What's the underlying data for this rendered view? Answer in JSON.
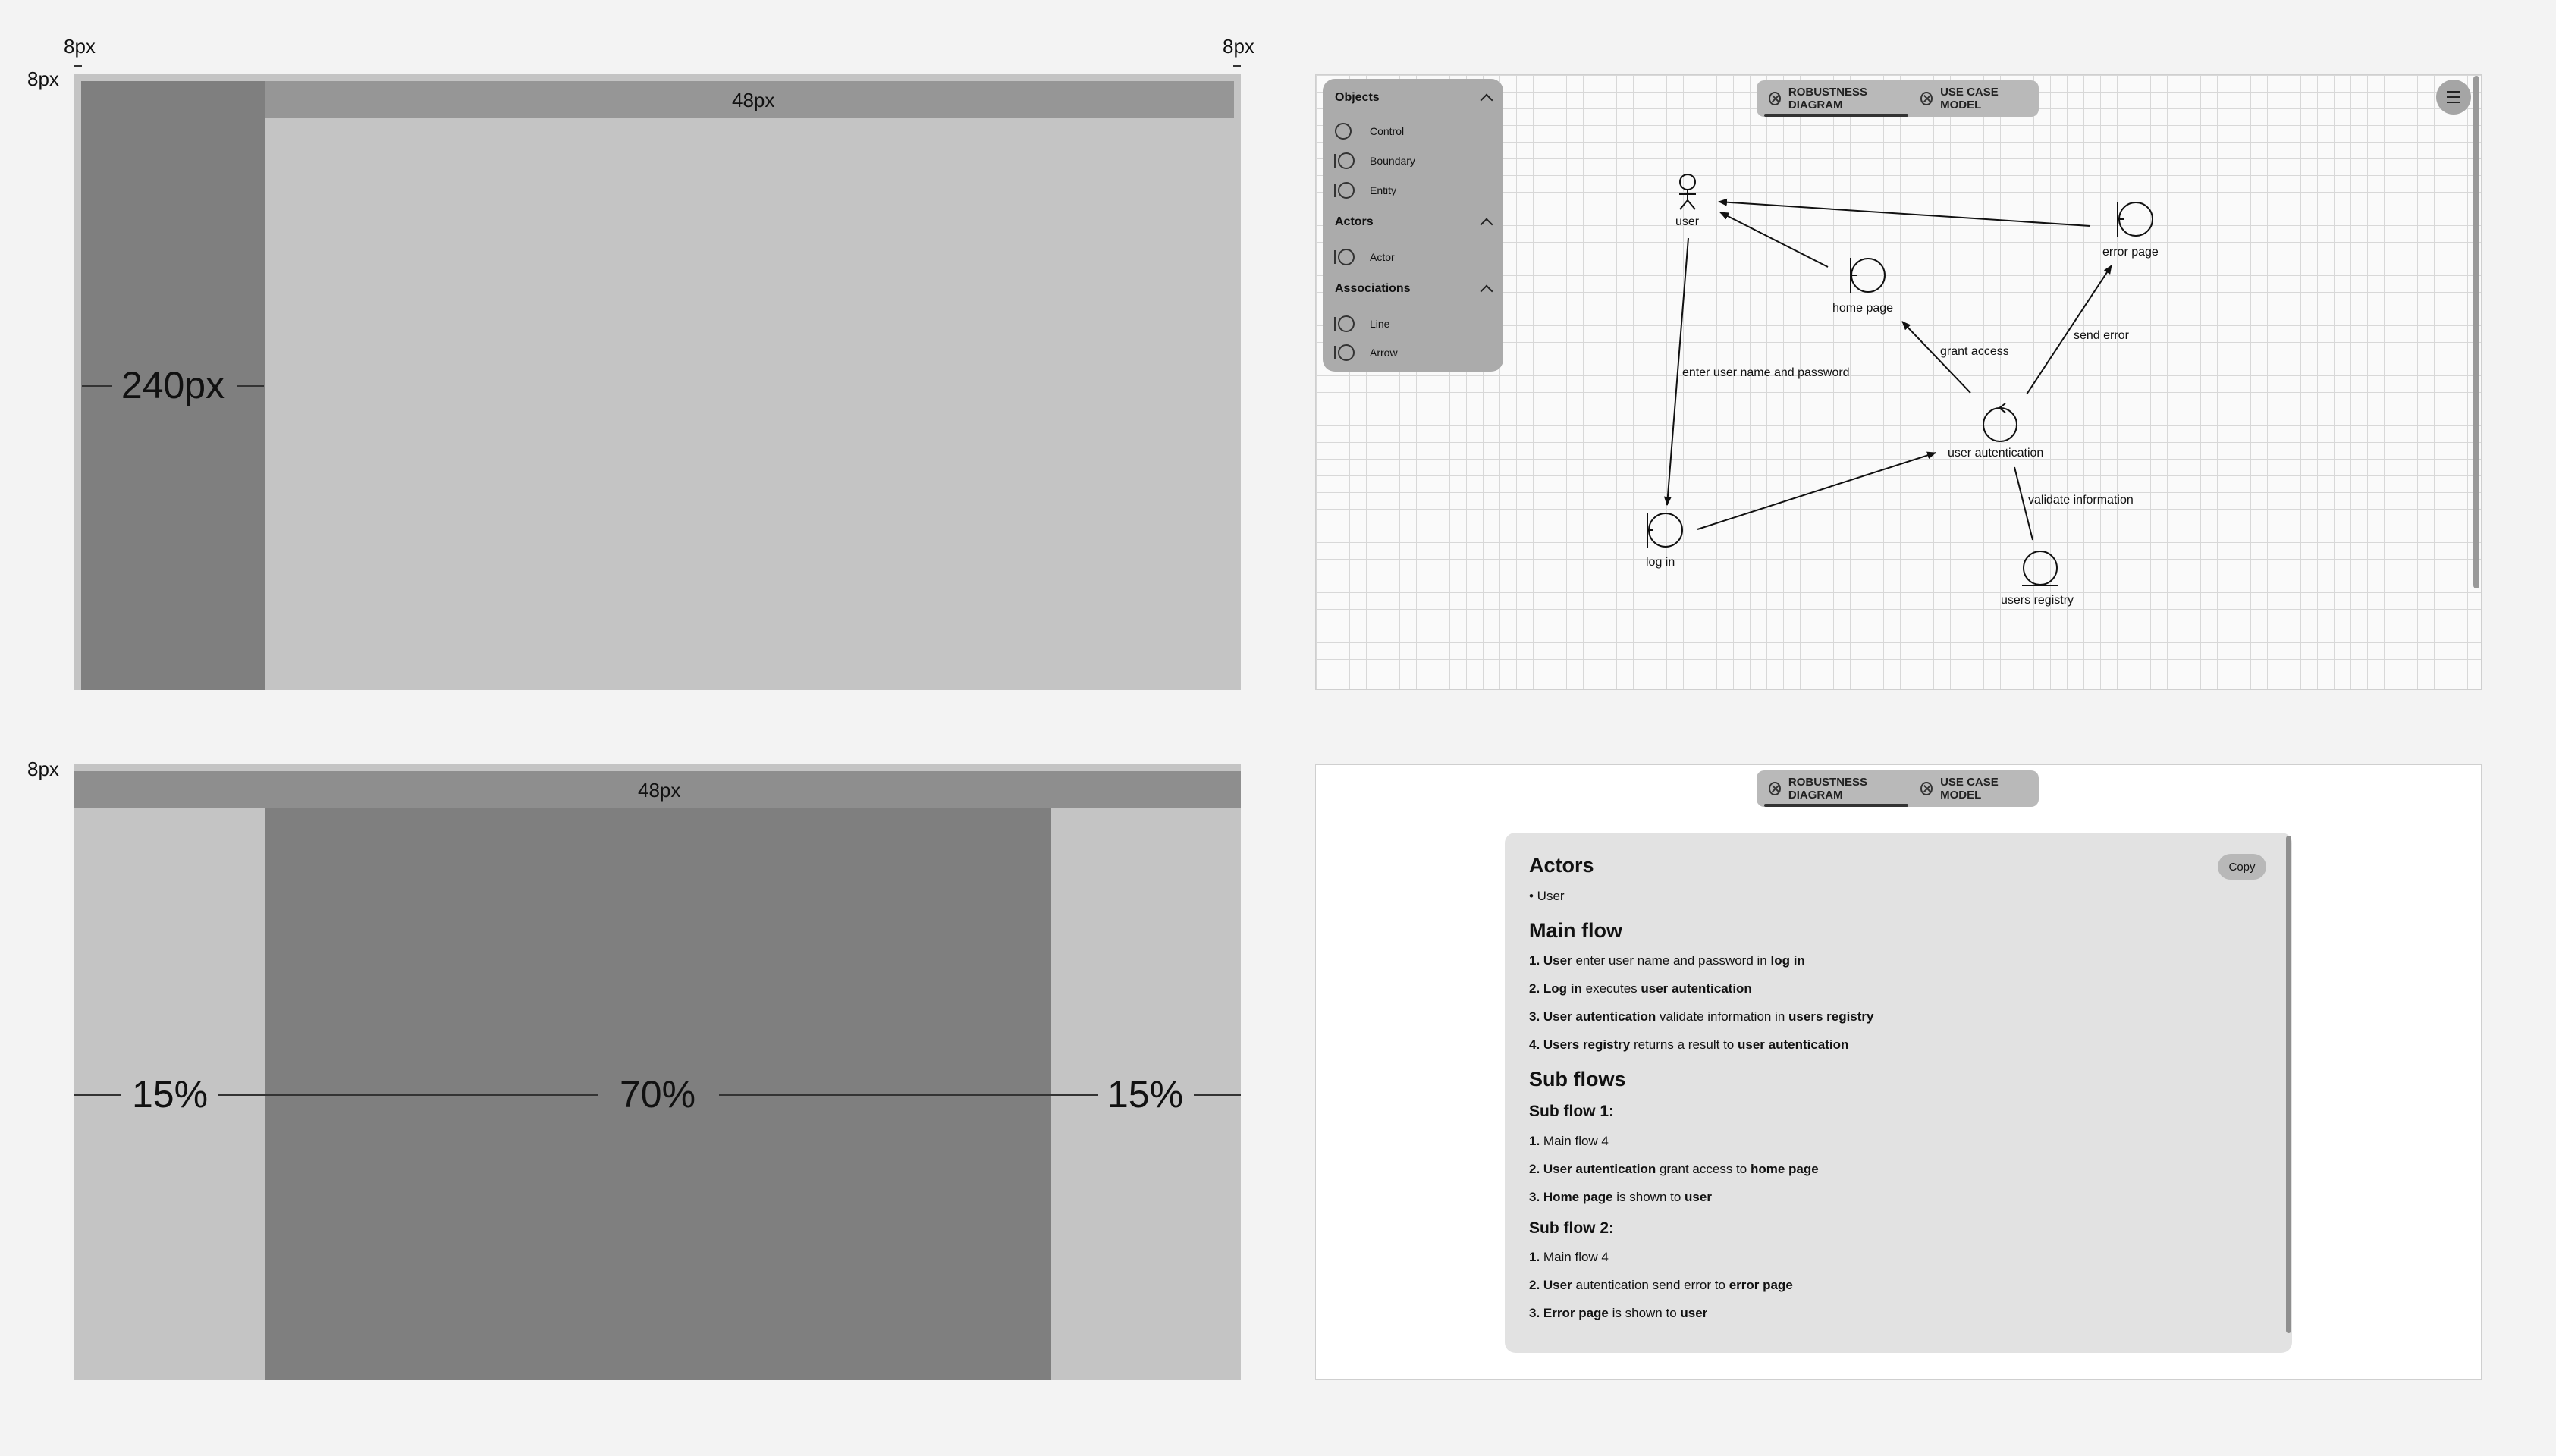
{
  "layout_spec_top": {
    "margin_left_label": "8px",
    "margin_right_label": "8px",
    "margin_top_label": "8px",
    "header_height_label": "48px",
    "sidebar_width_label": "240px"
  },
  "layout_spec_bottom": {
    "margin_top_label": "8px",
    "header_height_label": "48px",
    "col_left_label": "15%",
    "col_center_label": "70%",
    "col_right_label": "15%"
  },
  "tabs": {
    "robustness": "ROBUSTNESS DIAGRAM",
    "use_case": "USE CASE MODEL"
  },
  "palette": {
    "sections": [
      {
        "title": "Objects",
        "items": [
          "Control",
          "Boundary",
          "Entity"
        ]
      },
      {
        "title": "Actors",
        "items": [
          "Actor"
        ]
      },
      {
        "title": "Associations",
        "items": [
          "Line",
          "Arrow"
        ]
      }
    ]
  },
  "diagram": {
    "nodes": {
      "user": "user",
      "home_page": "home page",
      "error_page": "error page",
      "user_autentication": "user autentication",
      "log_in": "log in",
      "users_registry": "users registry"
    },
    "edges": {
      "enter": "enter user name and password",
      "grant": "grant access",
      "send_error": "send error",
      "validate": "validate information"
    }
  },
  "doc": {
    "copy_label": "Copy",
    "actors_title": "Actors",
    "actors_item": "• User",
    "main_flow_title": "Main flow",
    "main_flow": [
      {
        "n": "1.",
        "a": "User",
        "b": " enter user name and password in ",
        "c": "log in",
        "d": ""
      },
      {
        "n": "2.",
        "a": "Log in",
        "b": " executes ",
        "c": "user autentication",
        "d": ""
      },
      {
        "n": "3.",
        "a": "User autentication",
        "b": " validate information in ",
        "c": "users registry",
        "d": ""
      },
      {
        "n": "4.",
        "a": "Users registry",
        "b": " returns a result to ",
        "c": "user autentication",
        "d": ""
      }
    ],
    "sub_flows_title": "Sub flows",
    "sub_flow1_title": "Sub flow 1:",
    "sub_flow1": [
      {
        "n": "1.",
        "a": "",
        "b": " Main flow 4",
        "c": "",
        "d": ""
      },
      {
        "n": "2.",
        "a": "User autentication",
        "b": " grant access to ",
        "c": "home page",
        "d": ""
      },
      {
        "n": "3.",
        "a": "Home page",
        "b": " is shown to ",
        "c": "user",
        "d": ""
      }
    ],
    "sub_flow2_title": "Sub flow 2:",
    "sub_flow2": [
      {
        "n": "1.",
        "a": "",
        "b": " Main flow 4",
        "c": "",
        "d": ""
      },
      {
        "n": "2.",
        "a": "User",
        "b": " autentication send error to ",
        "c": "error page",
        "d": ""
      },
      {
        "n": "3.",
        "a": "Error page",
        "b": " is shown to ",
        "c": "user",
        "d": ""
      }
    ]
  },
  "colors": {
    "background": "#f3f3f3",
    "frame": "#c4c4c4",
    "header": "#8e8e8e",
    "sidebar": "#7f7f7f",
    "content_card": "#e2e2e2",
    "palette": "#ababab"
  }
}
